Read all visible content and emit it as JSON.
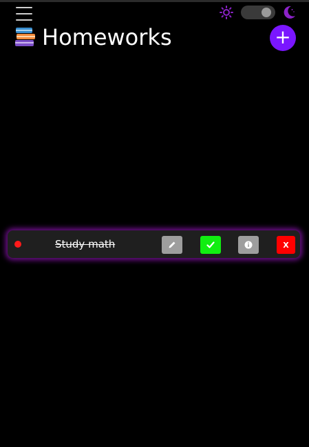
{
  "header": {
    "title": "Homeworks",
    "add_label": "+",
    "theme_toggle": {
      "mode": "dark"
    }
  },
  "icons": {
    "menu": "hamburger-menu-icon",
    "light": "sun-icon",
    "dark": "moon-icon",
    "logo": "books-icon"
  },
  "tasks": [
    {
      "title": "Study math",
      "completed": true,
      "status_color": "#ff1a1a",
      "delete_label": "X"
    }
  ],
  "colors": {
    "accent": "#7a16ff",
    "theme_icon": "#8b22c8",
    "done": "#11ee11",
    "delete": "#ff0000",
    "neutral_button": "#9e9e9e",
    "glow": "#9614be"
  }
}
